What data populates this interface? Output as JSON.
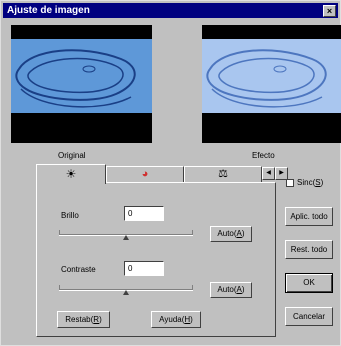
{
  "window": {
    "title": "Ajuste de imagen",
    "close_glyph": "×"
  },
  "previews": {
    "original_label": "Original",
    "effect_label": "Efecto"
  },
  "tabs": [
    {
      "icon": "brightness-icon",
      "glyph": "☀"
    },
    {
      "icon": "color-wheel-icon",
      "glyph": "◕"
    },
    {
      "icon": "balance-icon",
      "glyph": "⚖"
    }
  ],
  "tab_scroll": {
    "left": "◀",
    "right": "▶"
  },
  "sync": {
    "label_pre": "Sinc(",
    "label_key": "S",
    "label_post": ")"
  },
  "brightness": {
    "label": "Brillo",
    "value": "0",
    "slider_level": 0.5,
    "auto_pre": "Auto(",
    "auto_key": "A",
    "auto_post": ")"
  },
  "contrast": {
    "label": "Contraste",
    "value": "0",
    "slider_level": 0.5,
    "auto_pre": "Auto(",
    "auto_key": "A",
    "auto_post": ")"
  },
  "panel_buttons": {
    "restore_pre": "Restab(",
    "restore_key": "R",
    "restore_post": ")",
    "help_pre": "Ayuda(",
    "help_key": "H",
    "help_post": ")"
  },
  "side_buttons": {
    "apply_all": "Aplic. todo",
    "reset_all": "Rest. todo",
    "ok": "OK",
    "cancel": "Cancelar"
  },
  "colors": {
    "title_bar": "#000080",
    "face": "#c0c0c0",
    "original_bg": "#5e98d8",
    "effect_bg": "#a9c6ef"
  }
}
